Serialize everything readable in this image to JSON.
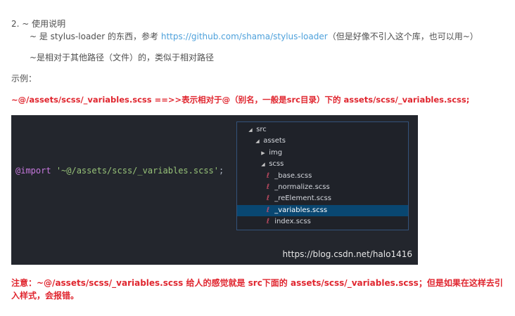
{
  "instructions": {
    "heading": "2. ~ 使用说明",
    "line1_prefix": "~ 是 stylus-loader 的东西，参考 ",
    "line1_link": "https://github.com/shama/stylus-loader",
    "line1_suffix": "（但是好像不引入这个库，也可以用~）",
    "line2": "~是相对于其他路径（文件）的，类似于相对路径",
    "example_label": "示例：",
    "example_line": "~@/assets/scss/_variables.scss    ==>>表示相对于@（别名，一般是src目录）下的 assets/scss/_variables.scss;"
  },
  "screenshot": {
    "code": {
      "keyword": "@import",
      "string": "'~@/assets/scss/_variables.scss'",
      "punct": ";"
    },
    "tree": [
      {
        "label": "src",
        "type": "folder-open"
      },
      {
        "label": "assets",
        "type": "folder-open"
      },
      {
        "label": "img",
        "type": "folder-closed"
      },
      {
        "label": "scss",
        "type": "folder-open"
      },
      {
        "label": "_base.scss",
        "type": "file"
      },
      {
        "label": "_normalize.scss",
        "type": "file"
      },
      {
        "label": "_reElement.scss",
        "type": "file"
      },
      {
        "label": "_variables.scss",
        "type": "file",
        "selected": true
      },
      {
        "label": "index.scss",
        "type": "file"
      }
    ],
    "watermark": "https://blog.csdn.net/halo1416",
    "icons": {
      "folder_open": "triangle-down-icon",
      "folder_closed": "triangle-right-icon",
      "file": "sass-file-icon"
    },
    "colors": {
      "background": "#23262d",
      "keyword": "#c678dd",
      "string": "#98c379",
      "selection": "#094771",
      "file_icon": "#e0526d"
    }
  },
  "notice": "注意：~@/assets/scss/_variables.scss 给人的感觉就是 src下面的 assets/scss/_variables.scss；但是如果在这样去引入样式，会报错。",
  "colors": {
    "text": "#4f4f4f",
    "link": "#4ea1db",
    "emphasis": "#e0262f"
  }
}
